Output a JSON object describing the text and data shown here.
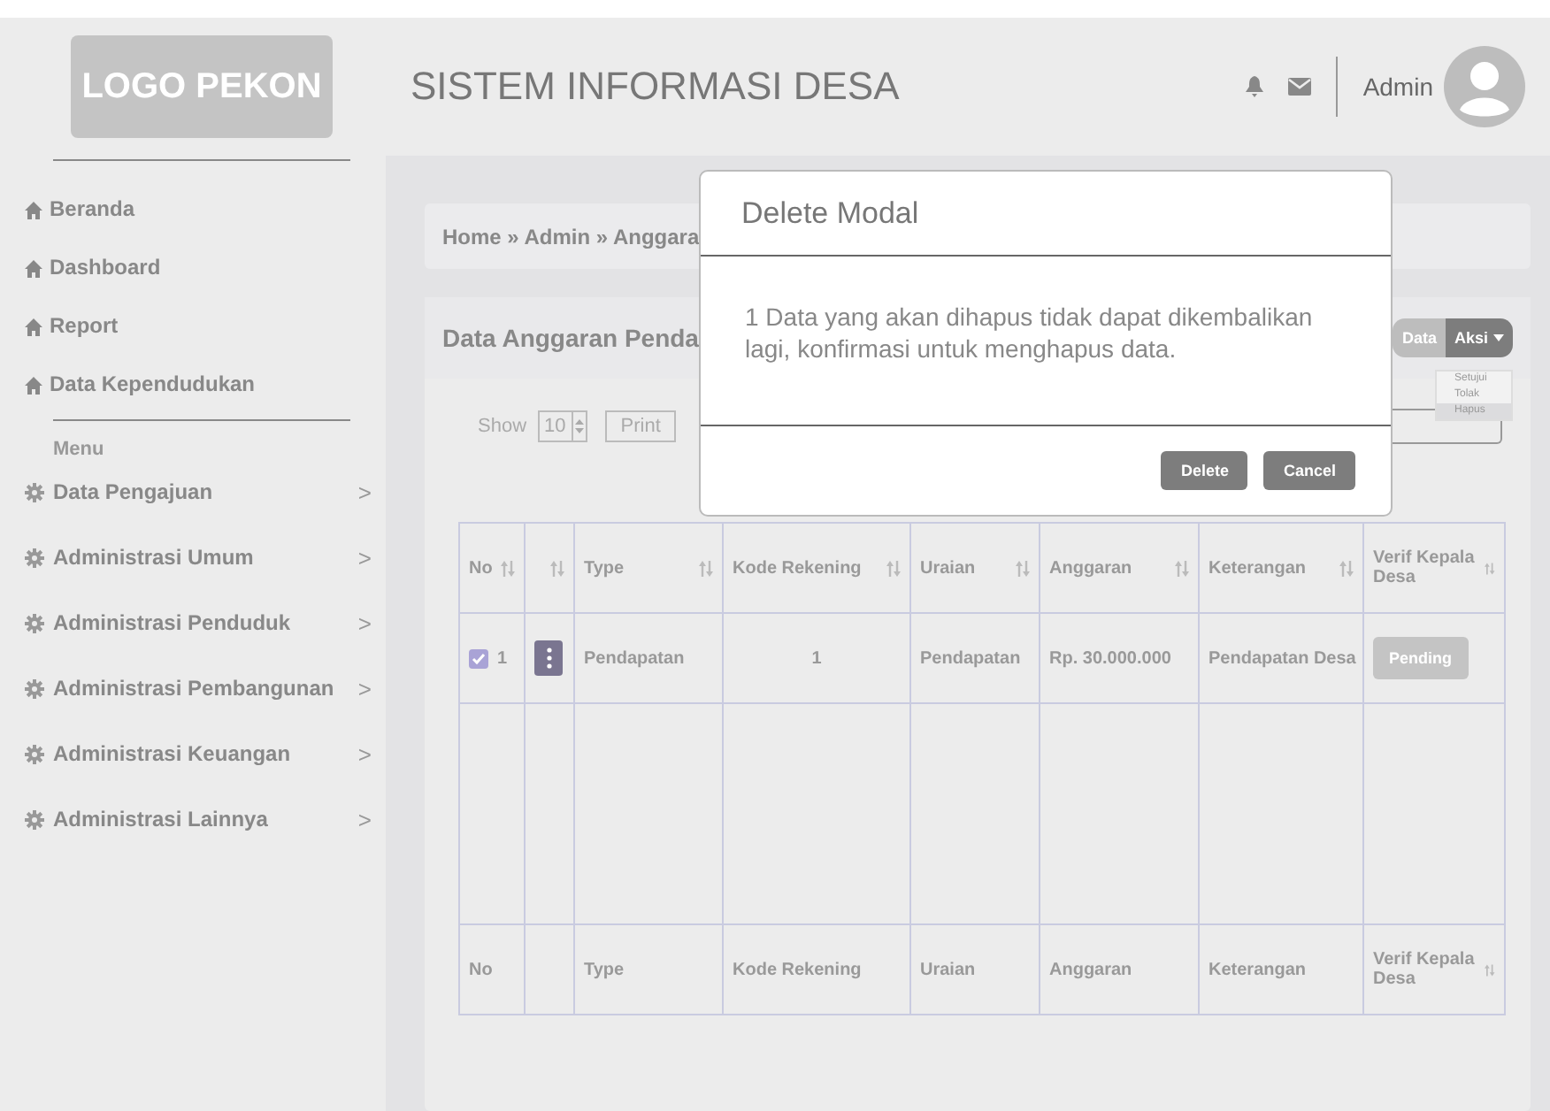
{
  "header": {
    "logo": "LOGO PEKON",
    "title": "SISTEM INFORMASI DESA",
    "user": "Admin"
  },
  "sidebar": {
    "links": [
      {
        "label": "Beranda"
      },
      {
        "label": "Dashboard"
      },
      {
        "label": "Report"
      },
      {
        "label": "Data Kependudukan"
      }
    ],
    "section": "Menu",
    "menu": [
      {
        "label": "Data Pengajuan",
        "arrow": ">"
      },
      {
        "label": "Administrasi Umum",
        "arrow": ">"
      },
      {
        "label": "Administrasi Penduduk",
        "arrow": ">"
      },
      {
        "label": "Administrasi Pembangunan",
        "arrow": ">"
      },
      {
        "label": "Administrasi Keuangan",
        "arrow": ">"
      },
      {
        "label": "Administrasi Lainnya",
        "arrow": ">"
      }
    ]
  },
  "breadcrumb": "Home » Admin » Anggara",
  "card": {
    "title": "Data Anggaran Penda",
    "show_label": "Show",
    "page_size": "10",
    "print": "Print",
    "data_button": "Data",
    "action_button": "Aksi",
    "action_menu": [
      {
        "label": "Setujui",
        "selected": false
      },
      {
        "label": "Tolak",
        "selected": false
      },
      {
        "label": "Hapus",
        "selected": true
      }
    ]
  },
  "table": {
    "columns": [
      {
        "label": "No",
        "sortable": true
      },
      {
        "sortable": true
      },
      {
        "label": "Type",
        "sortable": true
      },
      {
        "label": "Kode Rekening",
        "sortable": true
      },
      {
        "label": "Uraian",
        "sortable": true
      },
      {
        "label": "Anggaran",
        "sortable": true
      },
      {
        "label": "Keterangan",
        "sortable": true
      },
      {
        "label": "Verif Kepala Desa",
        "sortable": true
      }
    ],
    "rows": [
      {
        "checked": true,
        "no": "1",
        "type": "Pendapatan",
        "kode_rekening": "1",
        "uraian": "Pendapatan",
        "anggaran": "Rp. 30.000.000",
        "keterangan": "Pendapatan Desa",
        "status": "Pending"
      }
    ],
    "footer": [
      {
        "label": "No",
        "sortable": false
      },
      {
        "sortable": false
      },
      {
        "label": "Type",
        "sortable": false
      },
      {
        "label": "Kode Rekening",
        "sortable": false
      },
      {
        "label": "Uraian",
        "sortable": false
      },
      {
        "label": "Anggaran",
        "sortable": false
      },
      {
        "label": "Keterangan",
        "sortable": false
      },
      {
        "label": "Verif Kepala Desa",
        "sortable": true
      }
    ]
  },
  "modal": {
    "title": "Delete Modal",
    "message": "1 Data yang akan dihapus tidak dapat dikembalikan lagi, konfirmasi untuk menghapus data.",
    "buttons": [
      {
        "label": "Delete"
      },
      {
        "label": "Cancel"
      }
    ]
  }
}
